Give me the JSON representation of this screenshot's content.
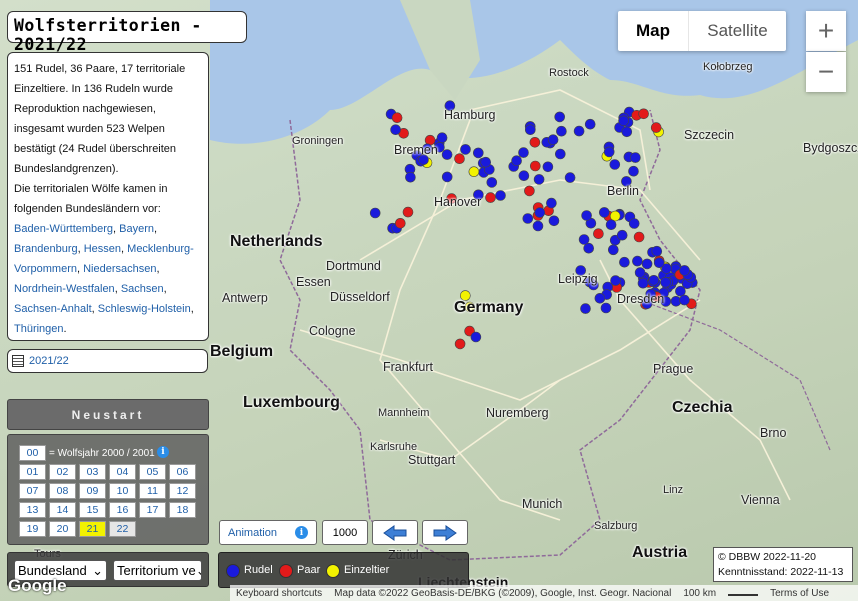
{
  "app": {
    "title": "Wolfsterritorien - 2021/22"
  },
  "info": {
    "summary": "151 Rudel, 36 Paare, 17 territoriale Einzeltiere. In 136 Rudeln wurde Reproduktion nachgewiesen, insgesamt wurden 523 Welpen bestätigt (24 Rudel überschreiten Bundeslandgrenzen).",
    "states_intro": "Die territorialen Wölfe kamen in folgenden Bundesländern vor:",
    "states": [
      "Baden-Württemberg",
      "Bayern",
      "Brandenburg",
      "Hessen",
      "Mecklenburg-Vorpommern",
      "Niedersachsen",
      "Nordrhein-Westfalen",
      "Sachsen",
      "Sachsen-Anhalt",
      "Schleswig-Holstein",
      "Thüringen"
    ]
  },
  "season": "2021/22",
  "restart_label": "Neustart",
  "year_grid": {
    "note": "= Wolfsjahr 2000 / 2001",
    "buttons": [
      "00",
      "01",
      "02",
      "03",
      "04",
      "05",
      "06",
      "07",
      "08",
      "09",
      "10",
      "11",
      "12",
      "13",
      "14",
      "15",
      "16",
      "17",
      "18",
      "19",
      "20",
      "21",
      "22"
    ],
    "selected": "21"
  },
  "selects": {
    "region": "Bundesland",
    "unit": "Territorium ve"
  },
  "animation": {
    "label": "Animation",
    "speed": "1000"
  },
  "legend": {
    "items": [
      {
        "label": "Rudel",
        "color": "#1a1adc"
      },
      {
        "label": "Paar",
        "color": "#e21a1a"
      },
      {
        "label": "Einzeltier",
        "color": "#f2f200"
      }
    ]
  },
  "map_controls": {
    "map": "Map",
    "satellite": "Satellite",
    "zoom_in": "+",
    "zoom_out": "−"
  },
  "credits": {
    "line1": "© DBBW 2022-11-20",
    "line2": "Kenntnisstand: 2022-11-13"
  },
  "attribution": {
    "shortcuts": "Keyboard shortcuts",
    "mapdata": "Map data ©2022 GeoBasis-DE/BKG (©2009), Google, Inst. Geogr. Nacional",
    "scale": "100 km",
    "terms": "Terms of Use",
    "google": "Google"
  },
  "map_labels": {
    "countries": [
      "Netherlands",
      "Germany",
      "Belgium",
      "Luxembourg",
      "Czechia",
      "Austria"
    ],
    "cities": [
      "Hamburg",
      "Bremen",
      "Hanover",
      "Berlin",
      "Leipzig",
      "Dresden",
      "Dortmund",
      "Essen",
      "Düsseldorf",
      "Cologne",
      "Frankfurt",
      "Nuremberg",
      "Stuttgart",
      "Munich",
      "Prague",
      "Antwerp",
      "Szczecin",
      "Rostock",
      "Groningen",
      "Bydgoszcz",
      "Kołobrzeg",
      "Mannheim",
      "Karlsruhe",
      "Brno",
      "Vienna",
      "Salzburg",
      "Linz",
      "Zürich",
      "Liechtenstein",
      "Tours"
    ]
  }
}
